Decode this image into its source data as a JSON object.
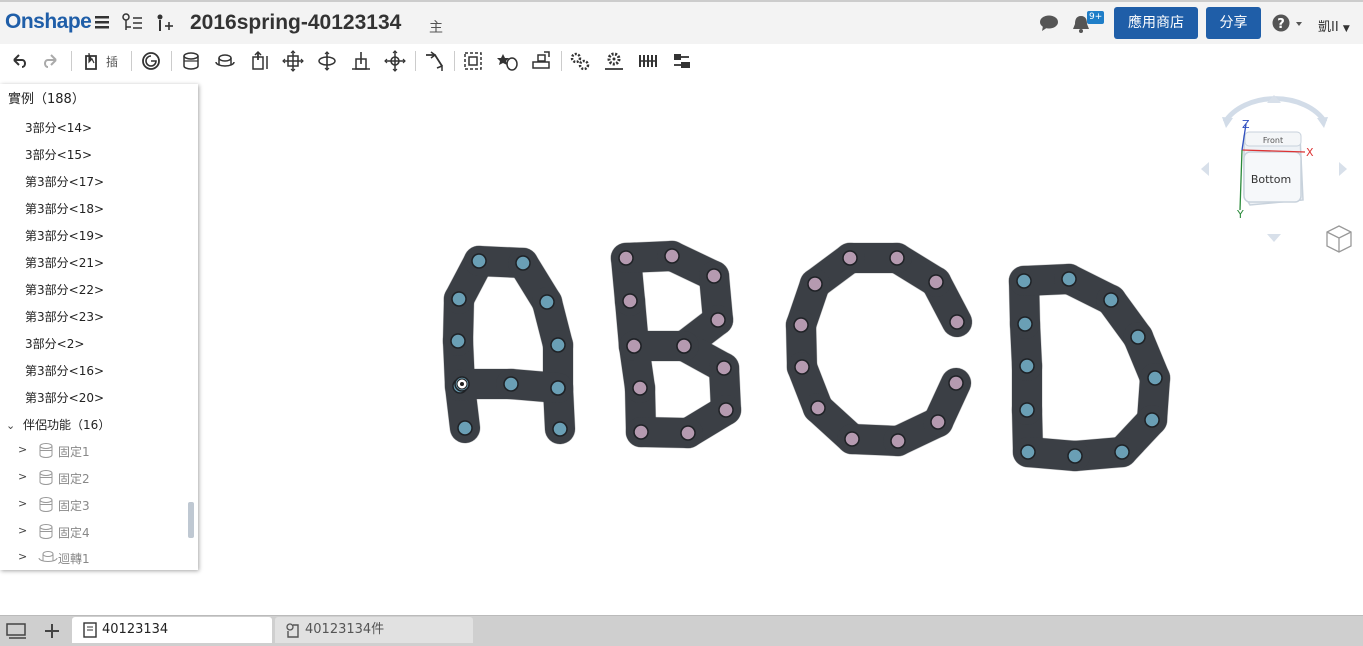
{
  "topbar": {
    "logo": "Onshape",
    "document_title": "2016spring-40123134",
    "branch": "主",
    "notification_count": "9+",
    "app_store_label": "應用商店",
    "share_label": "分享",
    "user_name": "凱II"
  },
  "toolbar": {
    "insert_label": "插"
  },
  "feature_panel": {
    "instances_header": "實例（188）",
    "instances": [
      "3部分<14>",
      "3部分<15>",
      "第3部分<17>",
      "第3部分<18>",
      "第3部分<19>",
      "第3部分<21>",
      "第3部分<22>",
      "第3部分<23>",
      "3部分<2>",
      "第3部分<16>",
      "第3部分<20>"
    ],
    "mates_header": "伴侶功能（16）",
    "mates": [
      {
        "label": "固定1",
        "icon": "fastened-mate-icon"
      },
      {
        "label": "固定2",
        "icon": "fastened-mate-icon"
      },
      {
        "label": "固定3",
        "icon": "fastened-mate-icon"
      },
      {
        "label": "固定4",
        "icon": "fastened-mate-icon"
      },
      {
        "label": "迴轉1",
        "icon": "revolute-mate-icon"
      }
    ]
  },
  "view_cube": {
    "front_label": "Front",
    "bottom_label": "Bottom",
    "axis_x": "X",
    "axis_y": "Y",
    "axis_z": "Z"
  },
  "tabs": [
    {
      "label": "40123134",
      "active": true
    },
    {
      "label": "40123134件",
      "active": false
    }
  ],
  "colors": {
    "brand": "#1f5ea8",
    "chain_link": "#3b3f45",
    "pin_blue": "#6a9fb5",
    "pin_pink": "#b59ab0"
  }
}
